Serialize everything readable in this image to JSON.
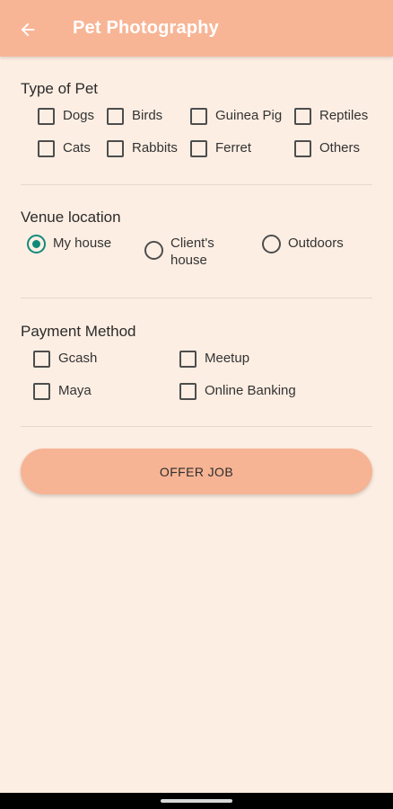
{
  "appbar": {
    "title": "Pet Photography",
    "back_icon": "arrow-left-icon",
    "color": "#F8B596"
  },
  "pet_type": {
    "title": "Type of Pet",
    "options": [
      {
        "label": "Dogs",
        "checked": false
      },
      {
        "label": "Birds",
        "checked": false
      },
      {
        "label": "Guinea Pig",
        "checked": false
      },
      {
        "label": "Reptiles",
        "checked": false
      },
      {
        "label": "Cats",
        "checked": false
      },
      {
        "label": "Rabbits",
        "checked": false
      },
      {
        "label": "Ferret",
        "checked": false
      },
      {
        "label": "Others",
        "checked": false
      }
    ]
  },
  "venue": {
    "title": "Venue location",
    "options": [
      {
        "label": "My house",
        "selected": true
      },
      {
        "label": "Client's house",
        "selected": false
      },
      {
        "label": "Outdoors",
        "selected": false
      }
    ]
  },
  "payment": {
    "title": "Payment Method",
    "options": [
      {
        "label": "Gcash",
        "checked": false
      },
      {
        "label": "Meetup",
        "checked": false
      },
      {
        "label": "Maya",
        "checked": false
      },
      {
        "label": "Online Banking",
        "checked": false
      }
    ]
  },
  "offer_button": {
    "label": "OFFER JOB"
  },
  "colors": {
    "background": "#FDEEE3",
    "accent": "#0F8A7A",
    "button": "#F6B494"
  }
}
